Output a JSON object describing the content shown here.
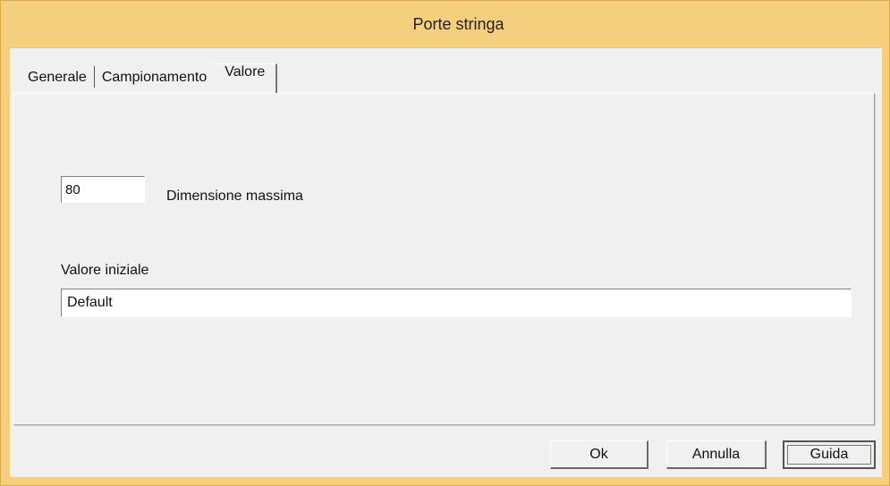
{
  "window": {
    "title": "Porte stringa"
  },
  "tabs": [
    {
      "label": "Generale",
      "active": false
    },
    {
      "label": "Campionamento",
      "active": false
    },
    {
      "label": "Valore",
      "active": true
    }
  ],
  "value_tab": {
    "max_size_value": "80",
    "max_size_label": "Dimensione massima",
    "initial_value_label": "Valore iniziale",
    "initial_value": "Default"
  },
  "buttons": {
    "ok": "Ok",
    "cancel": "Annulla",
    "help": "Guida"
  }
}
